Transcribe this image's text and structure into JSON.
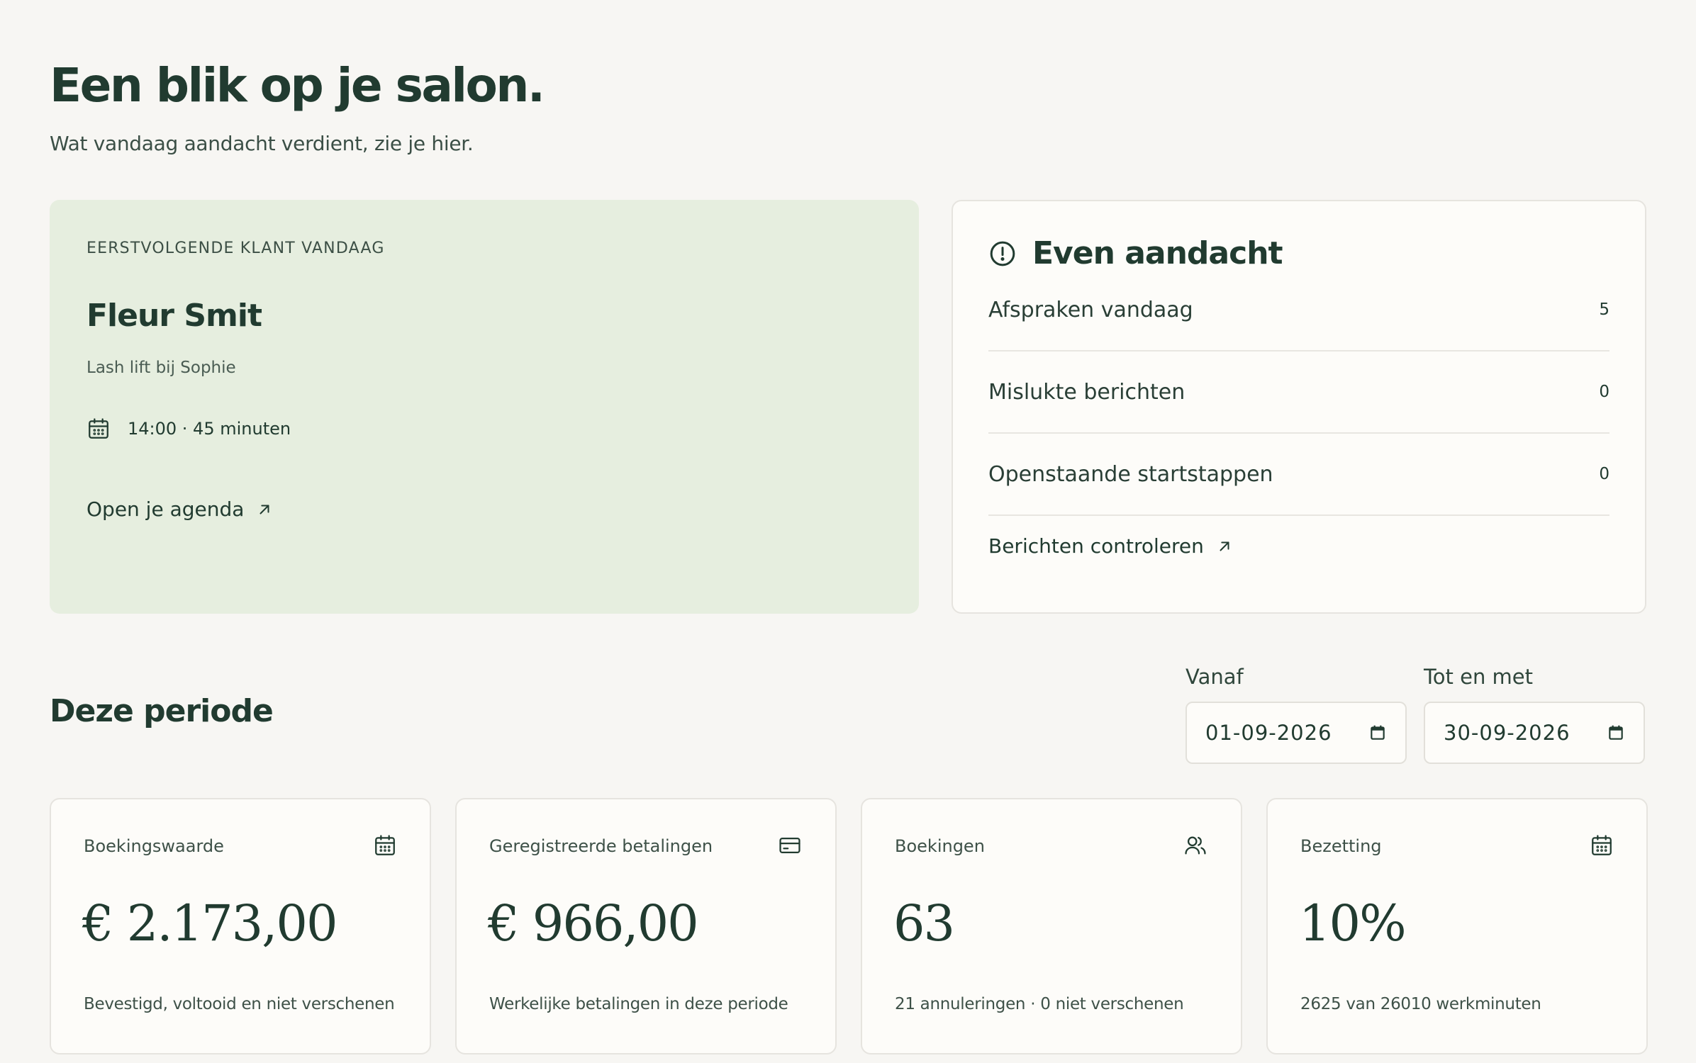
{
  "header": {
    "title": "Een blik op je salon.",
    "subtitle": "Wat vandaag aandacht verdient, zie je hier."
  },
  "next_client": {
    "eyebrow": "EERSTVOLGENDE KLANT VANDAAG",
    "name": "Fleur Smit",
    "service": "Lash lift bij Sophie",
    "time": "14:00 · 45 minuten",
    "link_label": "Open je agenda",
    "time_icon": "calendar-icon",
    "link_icon": "arrow-up-right-icon"
  },
  "attention": {
    "title": "Even aandacht",
    "icon": "alert-circle-icon",
    "rows": [
      {
        "label": "Afspraken vandaag",
        "count": "5"
      },
      {
        "label": "Mislukte berichten",
        "count": "0"
      },
      {
        "label": "Openstaande startstappen",
        "count": "0"
      }
    ],
    "link_label": "Berichten controleren"
  },
  "period": {
    "title": "Deze periode",
    "from_label": "Vanaf",
    "from_value": "01-09-2026",
    "to_label": "Tot en met",
    "to_value": "30-09-2026"
  },
  "stats": [
    {
      "label": "Boekingswaarde",
      "value": "€ 2.173,00",
      "foot": "Bevestigd, voltooid en niet verschenen",
      "icon": "calendar-icon"
    },
    {
      "label": "Geregistreerde betalingen",
      "value": "€ 966,00",
      "foot": "Werkelijke betalingen in deze periode",
      "icon": "credit-card-icon"
    },
    {
      "label": "Boekingen",
      "value": "63",
      "foot": "21 annuleringen · 0 niet verschenen",
      "icon": "users-icon"
    },
    {
      "label": "Bezetting",
      "value": "10%",
      "foot": "2625 van 26010 werkminuten",
      "icon": "calendar-icon"
    }
  ],
  "colors": {
    "background": "#f7f6f3",
    "text_primary": "#213b30",
    "highlight_card": "#e6eedf",
    "card": "#fdfcf9"
  }
}
